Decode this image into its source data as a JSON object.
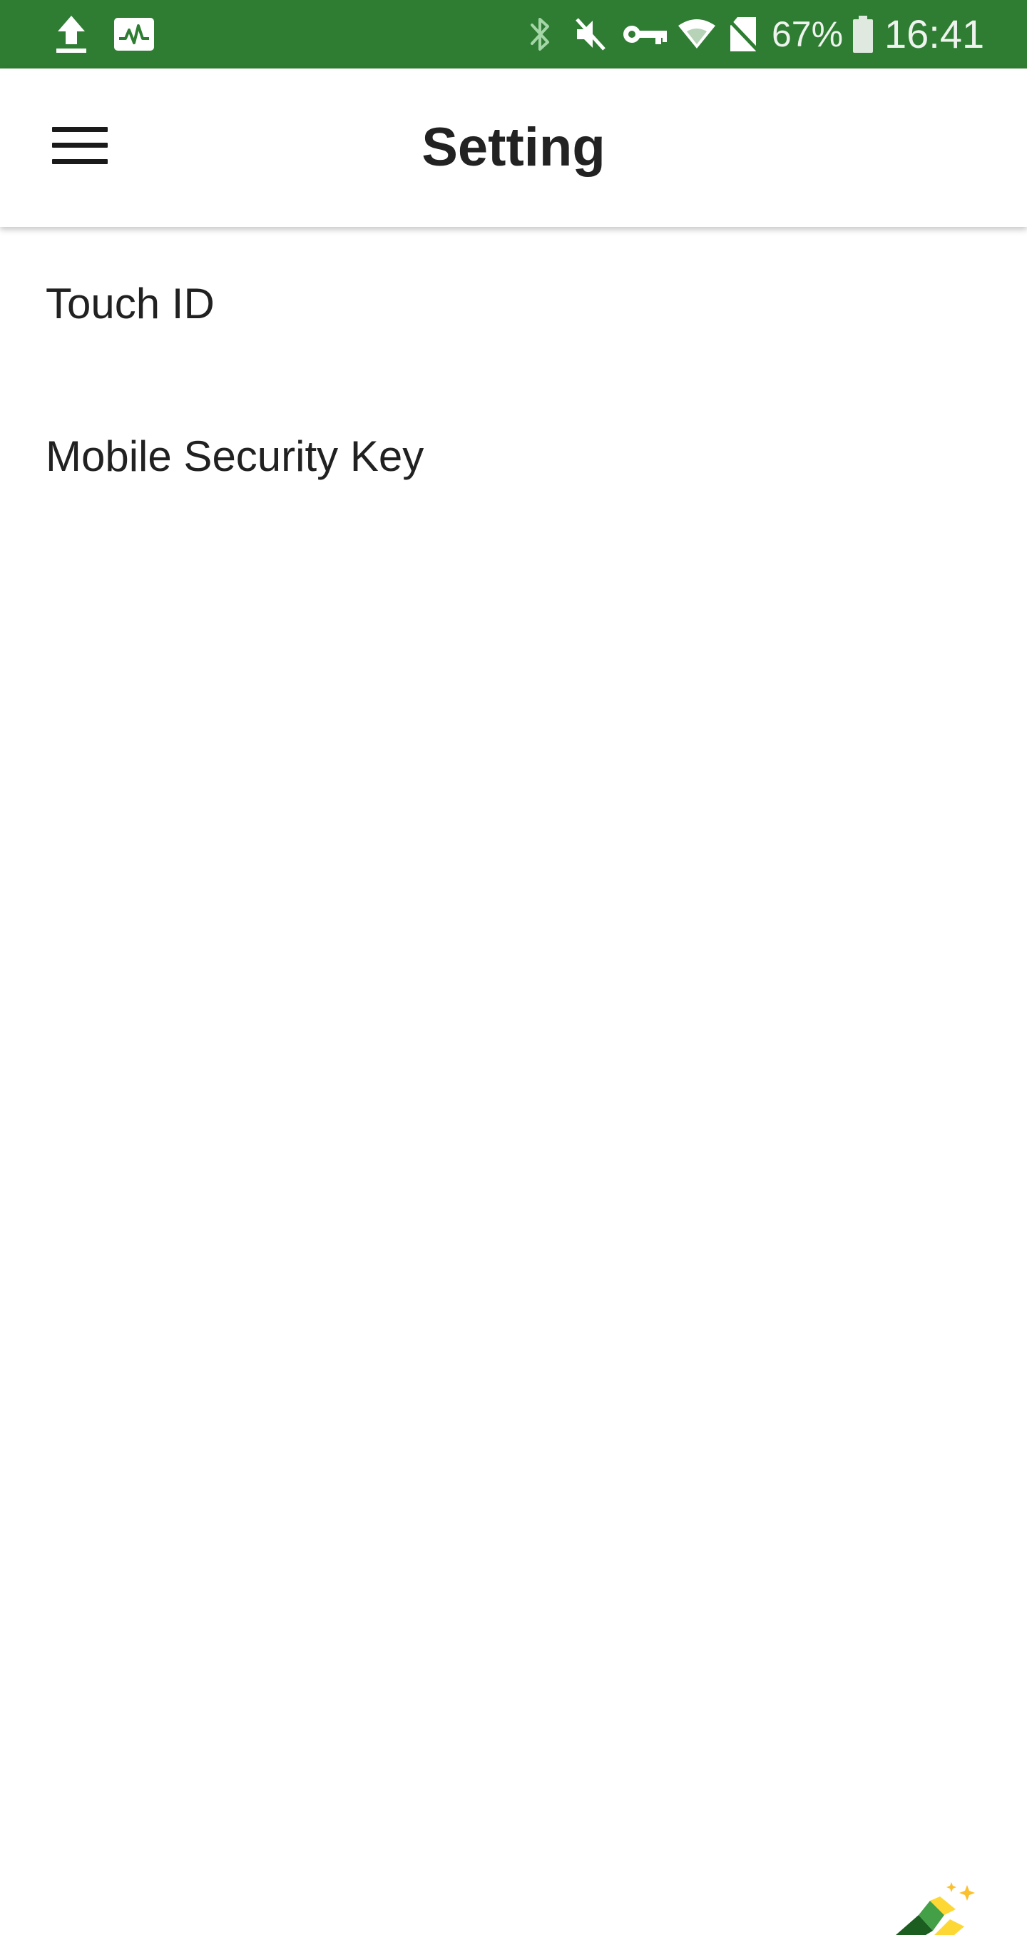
{
  "status_bar": {
    "background_color": "#2e7d32",
    "left_icons": [
      "upload-icon",
      "activity-monitor-icon"
    ],
    "right_icons": [
      "bluetooth-icon",
      "vibrate-mute-icon",
      "vpn-key-icon",
      "wifi-icon",
      "no-sim-icon",
      "battery-icon"
    ],
    "battery_percent": "67%",
    "time": "16:41"
  },
  "app_bar": {
    "title": "Setting",
    "menu_icon": "hamburger-menu-icon"
  },
  "settings": {
    "items": [
      {
        "label": "Touch ID"
      },
      {
        "label": "Mobile Security Key"
      }
    ]
  },
  "corner_graphic": {
    "icon": "sparkle-tool-icon",
    "colors": [
      "#1b5e20",
      "#43a047",
      "#fdd835"
    ]
  }
}
